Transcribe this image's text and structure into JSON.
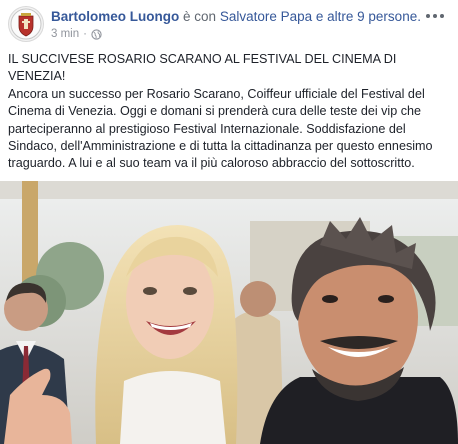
{
  "post": {
    "author_name": "Bartolomeo Luongo",
    "connector": "è con",
    "tagged_name": "Salvatore Papa",
    "tagged_others": "e altre 9 persone.",
    "timestamp": "3 min",
    "separator": "·",
    "privacy_icon": "globe-icon",
    "more_icon": "more-options-icon",
    "headline": "IL SUCCIVESE ROSARIO SCARANO AL FESTIVAL DEL CINEMA DI VENEZIA!",
    "body": "Ancora un successo per Rosario Scarano, Coiffeur ufficiale del Festival del Cinema di Venezia. Oggi e domani si prenderà cura delle teste dei vip che parteciperanno al prestigioso Festival Internazionale. Soddisfazione del Sindaco, dell'Amministrazione e di tutta la cittadinanza per questo ennesimo traguardo. A lui e al suo team va il più caloroso abbraccio del sottoscritto."
  },
  "colors": {
    "link": "#365899",
    "text": "#1d2129",
    "meta": "#90949c"
  }
}
